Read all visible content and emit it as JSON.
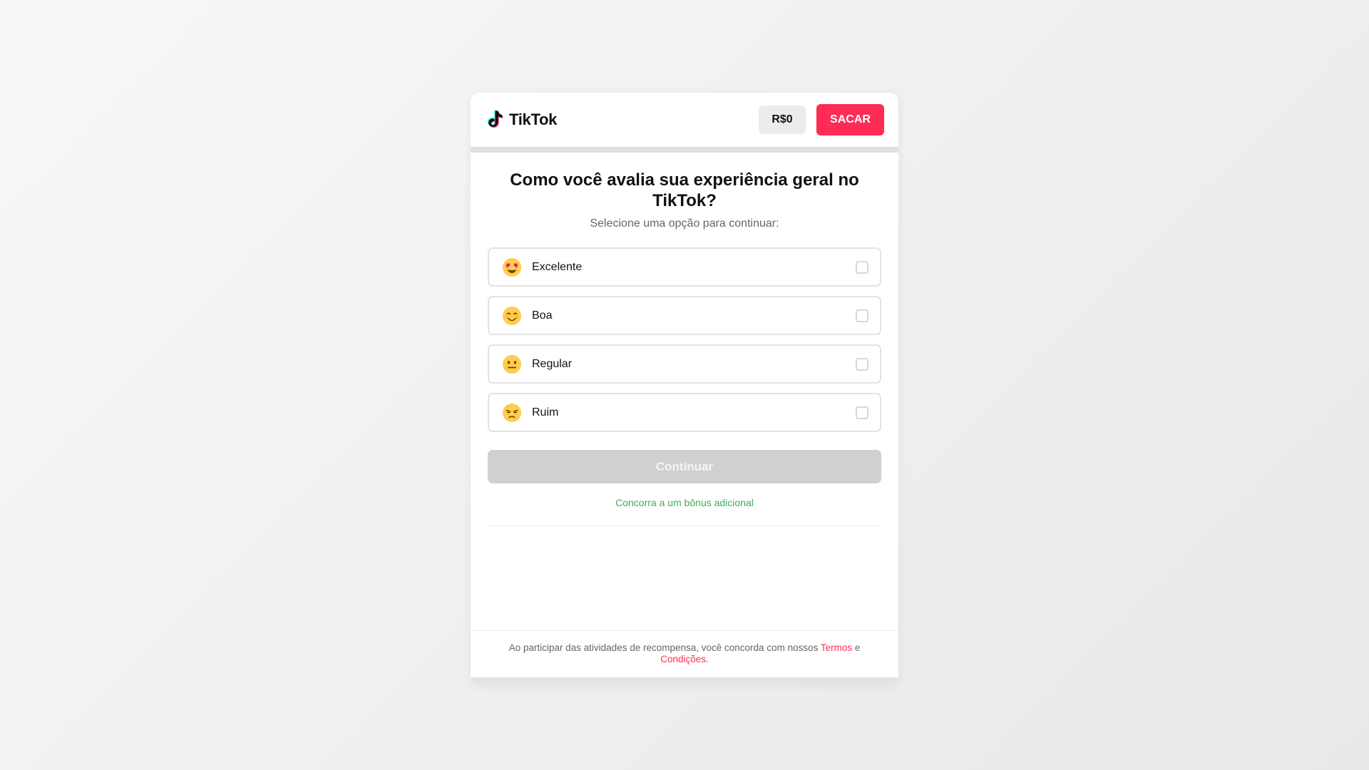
{
  "header": {
    "logo_text": "TikTok",
    "logo_icon": "tiktok-logo-icon",
    "balance": "R$0",
    "withdraw_label": "SACAR"
  },
  "progress": {
    "fraction": 0.0
  },
  "survey": {
    "question": "Como você avalia sua experiência geral no TikTok?",
    "subtitle": "Selecione uma opção para continuar:",
    "options": [
      {
        "emoji": "heart-eyes-emoji",
        "label": "Excelente",
        "checked": false
      },
      {
        "emoji": "smiling-emoji",
        "label": "Boa",
        "checked": false
      },
      {
        "emoji": "neutral-face-emoji",
        "label": "Regular",
        "checked": false
      },
      {
        "emoji": "unamused-face-emoji",
        "label": "Ruim",
        "checked": false
      }
    ],
    "continue_label": "Continuar",
    "bonus_text": "Concorra a um bônus adicional"
  },
  "footer": {
    "text_before": "Ao participar das atividades de recompensa, você concorda com nossos ",
    "terms_link": "Termos",
    "text_middle": " e ",
    "conditions_link": "Condições",
    "text_after": "."
  },
  "colors": {
    "accent": "#fe2c55",
    "bonus": "#3fae54",
    "disabled_button": "#d0d0d0"
  }
}
